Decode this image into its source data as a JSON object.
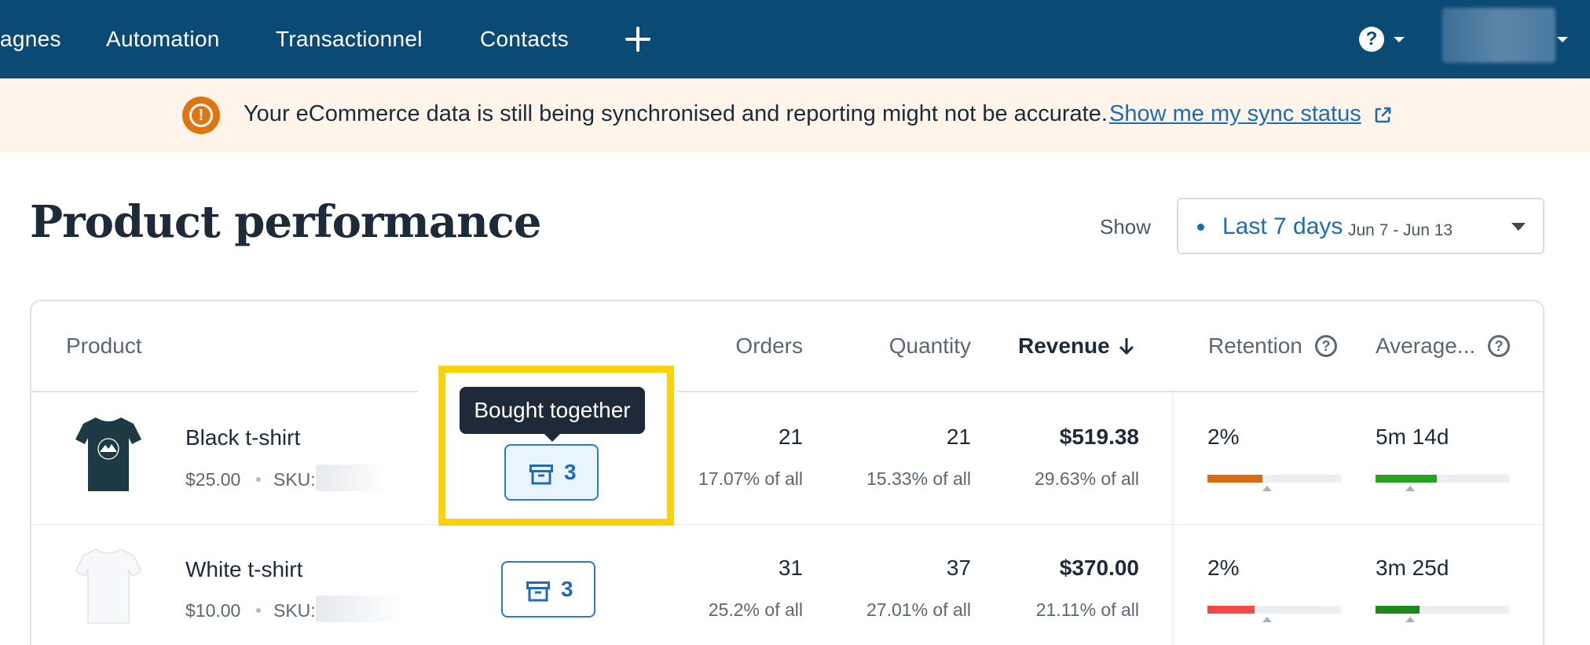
{
  "nav": {
    "items": [
      "agnes",
      "Automation",
      "Transactionnel",
      "Contacts"
    ],
    "help": "?"
  },
  "banner": {
    "alert": "!",
    "text": "Your eCommerce data is still being synchronised and reporting might not be accurate.",
    "link": "Show me my sync status"
  },
  "page": {
    "title": "Product performance",
    "show_label": "Show",
    "date_range": "Last 7 days",
    "date_sub": "Jun 7 - Jun 13"
  },
  "table": {
    "headers": {
      "product": "Product",
      "orders": "Orders",
      "quantity": "Quantity",
      "revenue": "Revenue",
      "retention": "Retention",
      "average": "Average...",
      "help": "?"
    },
    "tooltip": "Bought together",
    "rows": [
      {
        "name": "Black t-shirt",
        "price": "$25.00",
        "sku_label": "SKU:",
        "bundle": "3",
        "orders": "21",
        "orders_pct": "17.07% of all",
        "quantity": "21",
        "quantity_pct": "15.33% of all",
        "revenue": "$519.38",
        "revenue_pct": "29.63% of all",
        "retention": "2%",
        "retention_fill": 0.41,
        "retention_color": "#d96b12",
        "average": "5m 14d",
        "average_fill": 0.46,
        "average_color": "#27a321"
      },
      {
        "name": "White t-shirt",
        "price": "$10.00",
        "sku_label": "SKU:",
        "bundle": "3",
        "orders": "31",
        "orders_pct": "25.2% of all",
        "quantity": "37",
        "quantity_pct": "27.01% of all",
        "revenue": "$370.00",
        "revenue_pct": "21.11% of all",
        "retention": "2%",
        "retention_fill": 0.35,
        "retention_color": "#ef4b4b",
        "average": "3m 25d",
        "average_fill": 0.33,
        "average_color": "#1b8a1b"
      }
    ]
  }
}
